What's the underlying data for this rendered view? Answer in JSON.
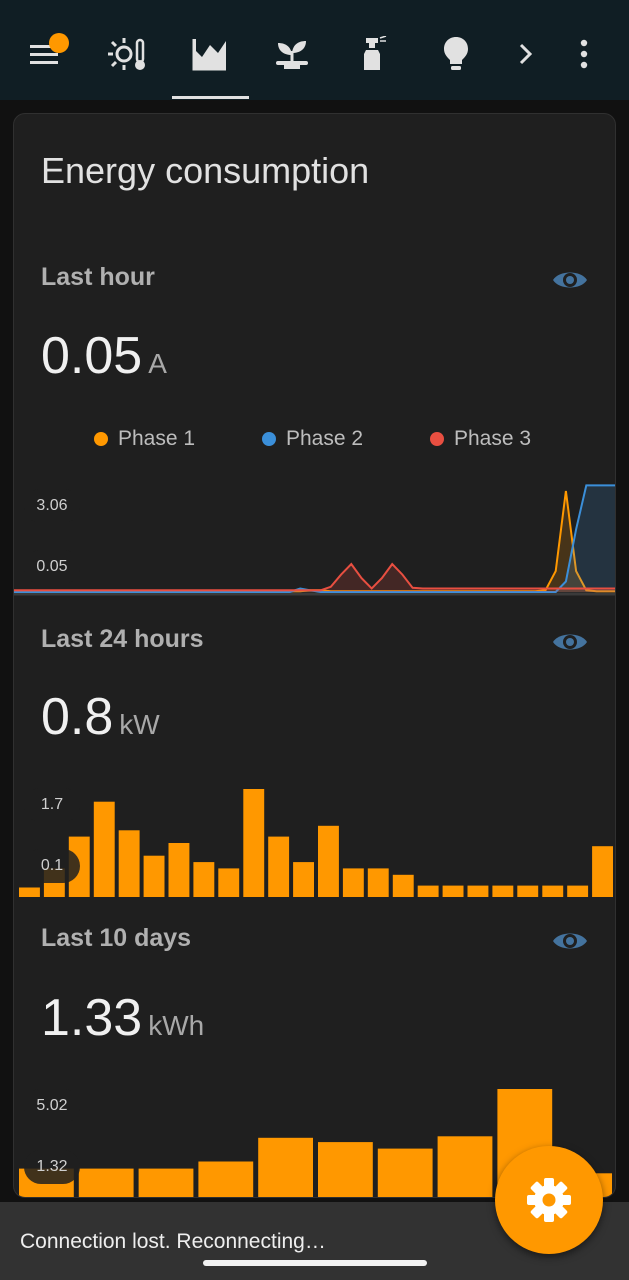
{
  "topbar": {
    "icons": [
      "menu-icon",
      "weather-icon",
      "energy-chart-icon",
      "plant-icon",
      "spray-bottle-icon",
      "lightbulb-icon",
      "chevron-right-icon",
      "more-vert-icon"
    ],
    "active_tab": "energy-chart-icon",
    "notification_color": "#ff9800"
  },
  "card": {
    "title": "Energy consumption"
  },
  "sensors": [
    {
      "name": "Last hour",
      "value": "0.05",
      "unit": "A",
      "legend": [
        "Phase 1",
        "Phase 2",
        "Phase 3"
      ],
      "y_labels": [
        "3.06",
        "0.05"
      ]
    },
    {
      "name": "Last 24 hours",
      "value": "0.8",
      "unit": "kW",
      "y_labels": [
        "1.7",
        "0.1"
      ]
    },
    {
      "name": "Last 10 days",
      "value": "1.33",
      "unit": "kWh",
      "y_labels": [
        "5.02",
        "1.32"
      ]
    }
  ],
  "chart_data": [
    {
      "type": "line",
      "title": "Last hour",
      "series": [
        {
          "name": "Phase 1",
          "color": "#ff9800",
          "values": [
            0.02,
            0.02,
            0.02,
            0.02,
            0.02,
            0.02,
            0.02,
            0.02,
            0.02,
            0.02,
            0.02,
            0.02,
            0.02,
            0.02,
            0.02,
            0.02,
            0.02,
            0.02,
            0.02,
            0.02,
            0.02,
            0.02,
            0.02,
            0.02,
            0.02,
            0.02,
            0.02,
            0.02,
            0.02,
            0.05,
            0.05,
            0.02,
            0.02,
            0.02,
            0.02,
            0.02,
            0.02,
            0.02,
            0.02,
            0.02,
            0.02,
            0.02,
            0.02,
            0.02,
            0.02,
            0.02,
            0.02,
            0.02,
            0.02,
            0.02,
            0.02,
            0.02,
            0.05,
            0.6,
            2.9,
            0.6,
            0.05,
            0.02,
            0.02,
            0.02
          ]
        },
        {
          "name": "Phase 2",
          "color": "#3b8fd9",
          "values": [
            0.0,
            0.0,
            0.0,
            0.0,
            0.0,
            0.0,
            0.0,
            0.0,
            0.0,
            0.0,
            0.0,
            0.0,
            0.0,
            0.0,
            0.0,
            0.0,
            0.0,
            0.0,
            0.0,
            0.0,
            0.0,
            0.0,
            0.0,
            0.0,
            0.0,
            0.0,
            0.0,
            0.0,
            0.1,
            0.05,
            0.0,
            0.0,
            0.0,
            0.0,
            0.0,
            0.0,
            0.0,
            0.0,
            0.0,
            0.0,
            0.0,
            0.0,
            0.0,
            0.0,
            0.0,
            0.0,
            0.0,
            0.0,
            0.0,
            0.0,
            0.0,
            0.0,
            0.0,
            0.0,
            0.3,
            1.8,
            3.06,
            3.06,
            3.06,
            3.06
          ]
        },
        {
          "name": "Phase 3",
          "color": "#e84f41",
          "values": [
            0.05,
            0.05,
            0.05,
            0.05,
            0.05,
            0.05,
            0.05,
            0.05,
            0.05,
            0.05,
            0.05,
            0.05,
            0.05,
            0.05,
            0.05,
            0.05,
            0.05,
            0.05,
            0.05,
            0.05,
            0.05,
            0.05,
            0.05,
            0.05,
            0.05,
            0.05,
            0.05,
            0.05,
            0.05,
            0.05,
            0.05,
            0.15,
            0.5,
            0.8,
            0.4,
            0.1,
            0.4,
            0.8,
            0.5,
            0.12,
            0.1,
            0.1,
            0.1,
            0.1,
            0.1,
            0.1,
            0.1,
            0.1,
            0.1,
            0.1,
            0.1,
            0.1,
            0.1,
            0.1,
            0.1,
            0.1,
            0.1,
            0.1,
            0.1,
            0.1
          ]
        }
      ],
      "y_labels": [
        "3.06",
        "0.05"
      ]
    },
    {
      "type": "bar",
      "title": "Last 24 hours",
      "color": "#ff9800",
      "values": [
        0.15,
        0.45,
        0.95,
        1.5,
        1.05,
        0.65,
        0.85,
        0.55,
        0.45,
        1.7,
        0.95,
        0.55,
        1.12,
        0.45,
        0.45,
        0.35,
        0.18,
        0.18,
        0.18,
        0.18,
        0.18,
        0.18,
        0.18,
        0.8
      ],
      "y_labels": [
        "1.7",
        "0.1"
      ]
    },
    {
      "type": "bar",
      "title": "Last 10 days",
      "color": "#ff9800",
      "values": [
        1.32,
        1.32,
        1.32,
        1.65,
        2.75,
        2.55,
        2.25,
        2.82,
        5.02,
        1.1
      ],
      "y_labels": [
        "5.02",
        "1.32"
      ]
    }
  ],
  "snackbar": {
    "message": "Connection lost. Reconnecting…"
  },
  "fab": {
    "icon": "settings-gear-icon",
    "color": "#ff9800"
  }
}
